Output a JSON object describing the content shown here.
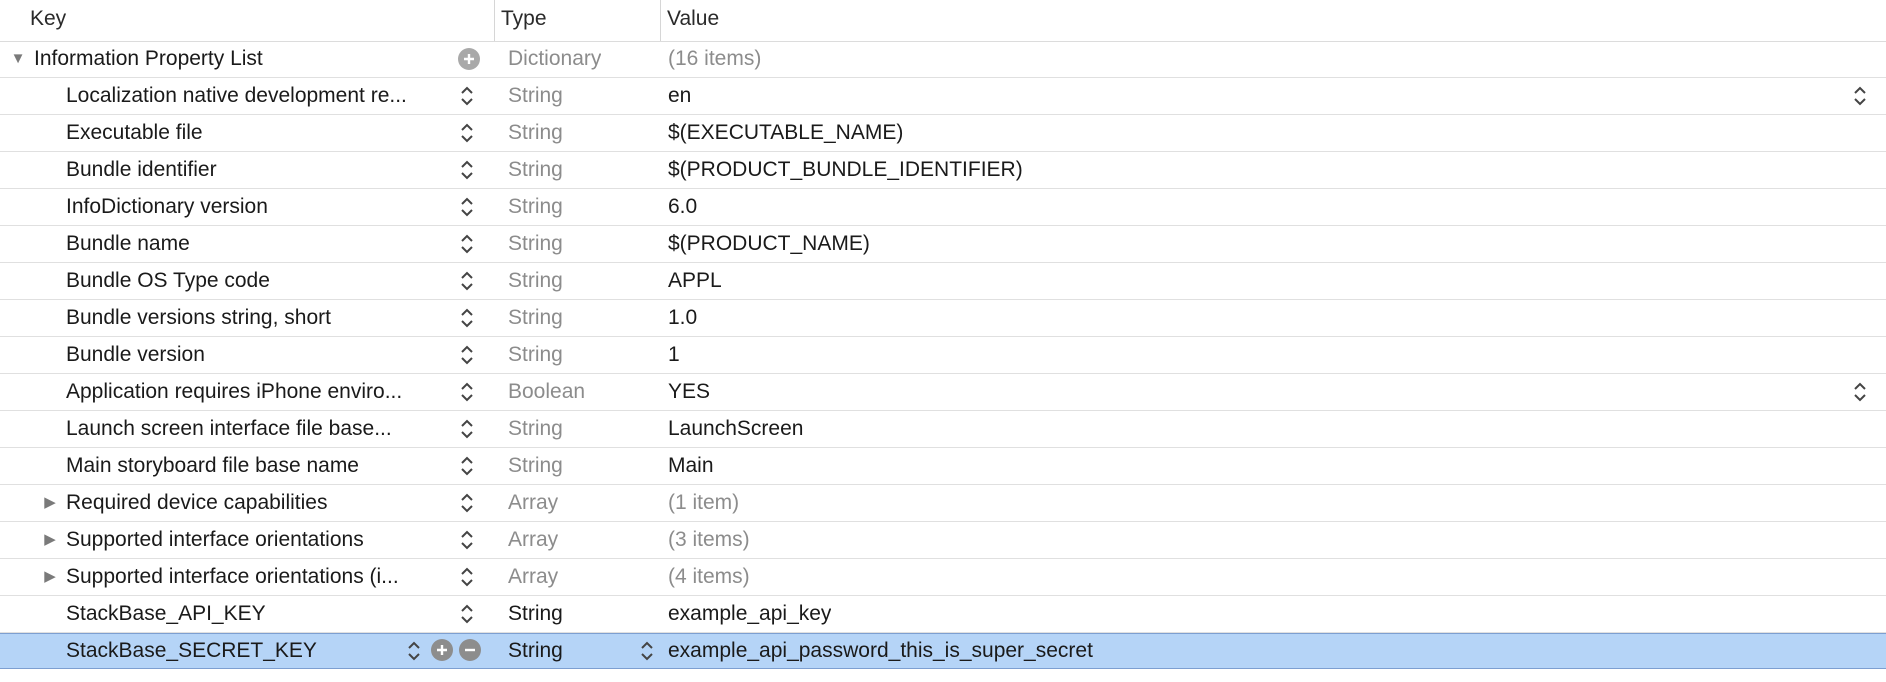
{
  "header": {
    "key": "Key",
    "type": "Type",
    "value": "Value"
  },
  "root": {
    "key": "Information Property List",
    "type": "Dictionary",
    "value": "(16 items)"
  },
  "rows": [
    {
      "key": "Localization native development re...",
      "type": "String",
      "value": "en",
      "value_stepper": true
    },
    {
      "key": "Executable file",
      "type": "String",
      "value": "$(EXECUTABLE_NAME)"
    },
    {
      "key": "Bundle identifier",
      "type": "String",
      "value": "$(PRODUCT_BUNDLE_IDENTIFIER)"
    },
    {
      "key": "InfoDictionary version",
      "type": "String",
      "value": "6.0"
    },
    {
      "key": "Bundle name",
      "type": "String",
      "value": "$(PRODUCT_NAME)"
    },
    {
      "key": "Bundle OS Type code",
      "type": "String",
      "value": "APPL"
    },
    {
      "key": "Bundle versions string, short",
      "type": "String",
      "value": "1.0"
    },
    {
      "key": "Bundle version",
      "type": "String",
      "value": "1"
    },
    {
      "key": "Application requires iPhone enviro...",
      "type": "Boolean",
      "value": "YES",
      "value_stepper": true
    },
    {
      "key": "Launch screen interface file base...",
      "type": "String",
      "value": "LaunchScreen"
    },
    {
      "key": "Main storyboard file base name",
      "type": "String",
      "value": "Main"
    },
    {
      "key": "Required device capabilities",
      "type": "Array",
      "value": "(1 item)",
      "expandable": true
    },
    {
      "key": "Supported interface orientations",
      "type": "Array",
      "value": "(3 items)",
      "expandable": true
    },
    {
      "key": "Supported interface orientations (i...",
      "type": "Array",
      "value": "(4 items)",
      "expandable": true
    },
    {
      "key": "StackBase_API_KEY",
      "type": "String",
      "value": "example_api_key",
      "emphasis": true
    },
    {
      "key": "StackBase_SECRET_KEY",
      "type": "String",
      "value": "example_api_password_this_is_super_secret",
      "emphasis": true,
      "selected": true
    }
  ],
  "icons": {
    "disclosure_open": "triangle-down-icon",
    "disclosure_closed": "triangle-right-icon",
    "stepper": "up-down-stepper-icon",
    "add": "plus-circle-icon",
    "remove": "minus-circle-icon"
  },
  "colors": {
    "selection": "#b5d4f7",
    "selection_border": "#7d9fd1",
    "secondary_text": "#8c8c8c"
  }
}
